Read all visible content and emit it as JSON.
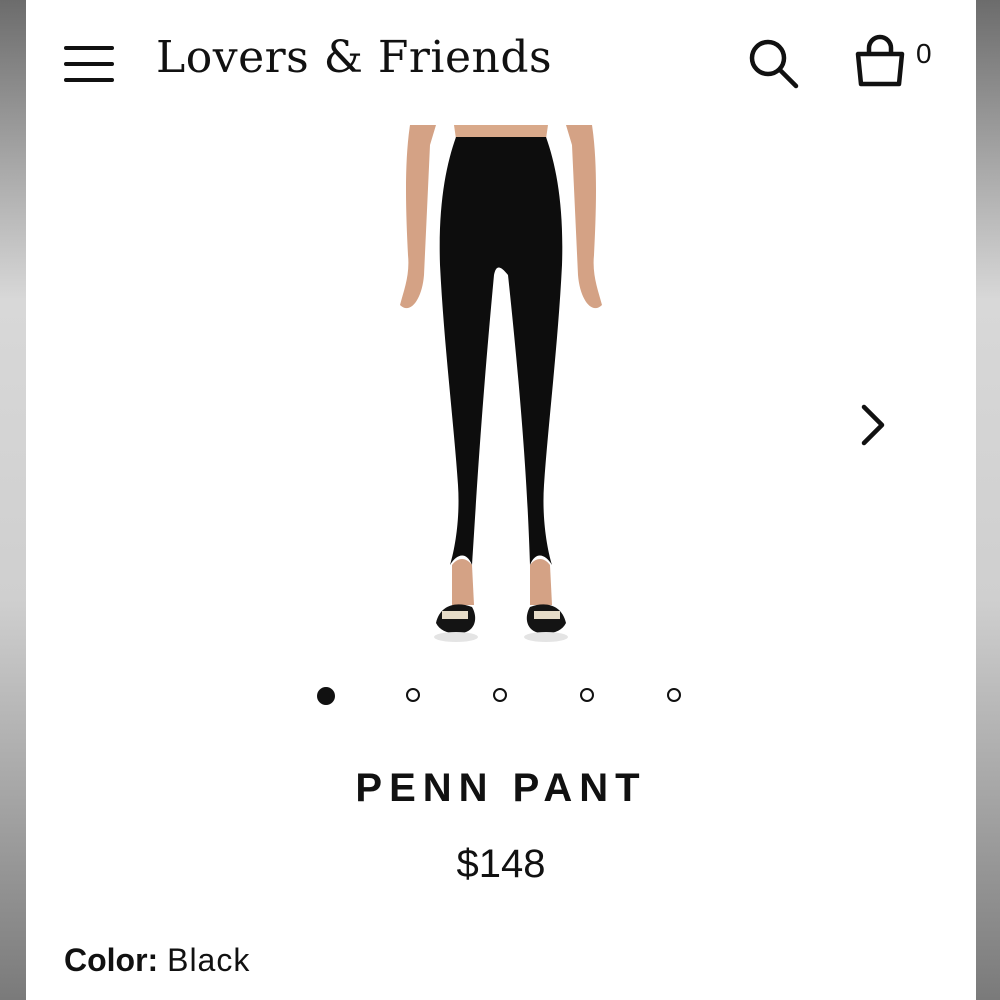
{
  "header": {
    "brand": "Lovers & Friends",
    "cart_count": "0",
    "icons": {
      "menu": "hamburger-menu-icon",
      "search": "search-icon",
      "cart": "shopping-bag-icon"
    }
  },
  "gallery": {
    "image_alt": "Penn Pant black stirrup leggings product photo",
    "next_icon": "chevron-right-icon",
    "dots_total": 5,
    "active_index": 0
  },
  "product": {
    "title": "PENN PANT",
    "price": "$148",
    "color_label": "Color:",
    "color_value": "Black"
  },
  "colors": {
    "text": "#111111",
    "background": "#ffffff",
    "pant": "#0d0d0d",
    "skin": "#d9a98a"
  }
}
